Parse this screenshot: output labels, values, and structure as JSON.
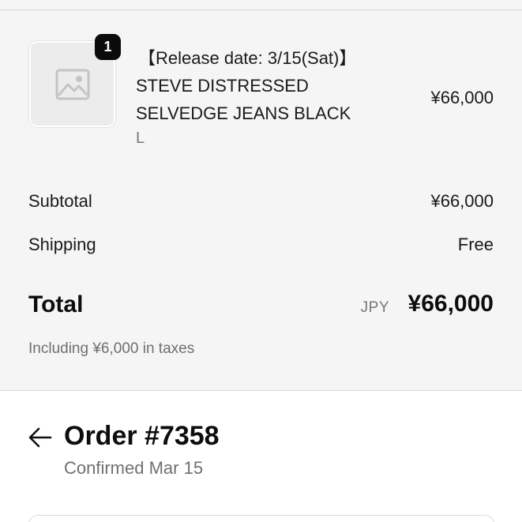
{
  "line_item": {
    "quantity": "1",
    "release_note": "【Release date: 3/15(Sat)】",
    "name_line1": "STEVE DISTRESSED",
    "name_line2": "SELVEDGE JEANS BLACK",
    "variant": "L",
    "price": "¥66,000",
    "image_icon": "image-placeholder-icon"
  },
  "summary": {
    "subtotal_label": "Subtotal",
    "subtotal_value": "¥66,000",
    "shipping_label": "Shipping",
    "shipping_value": "Free",
    "total_label": "Total",
    "currency": "JPY",
    "total_value": "¥66,000",
    "taxes_note": "Including ¥6,000 in taxes"
  },
  "order": {
    "back_icon": "arrow-left-icon",
    "title": "Order #7358",
    "status": "Confirmed Mar 15"
  },
  "colors": {
    "background": "#f5f5f5",
    "badge": "#0b0b0b",
    "muted_text": "#777777"
  }
}
